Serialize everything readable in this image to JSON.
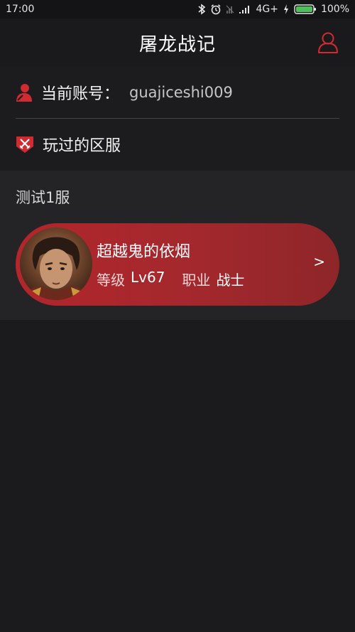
{
  "status_bar": {
    "time": "17:00",
    "network": "4G+",
    "battery": "100%"
  },
  "header": {
    "title": "屠龙战记"
  },
  "account": {
    "label": "当前账号：",
    "value": "guajiceshi009"
  },
  "played_servers": {
    "label": "玩过的区服"
  },
  "servers": [
    {
      "name": "测试1服",
      "characters": [
        {
          "name": "超越鬼的依烟",
          "level_label": "等级",
          "level_value": "Lv67",
          "class_label": "职业",
          "class_value": "战士",
          "arrow": ">"
        }
      ]
    }
  ],
  "colors": {
    "accent_red": "#c02b2f",
    "card_red": "#a3282d",
    "background": "#1c1c1e",
    "section_bg": "#242427"
  },
  "icons": {
    "profile": "user-outline-icon",
    "account": "user-filled-icon",
    "played": "crossed-swords-shield-icon",
    "bluetooth": "bluetooth-icon",
    "alarm": "alarm-icon",
    "signal": "signal-icon",
    "battery": "battery-icon",
    "charging": "charging-bolt-icon"
  }
}
